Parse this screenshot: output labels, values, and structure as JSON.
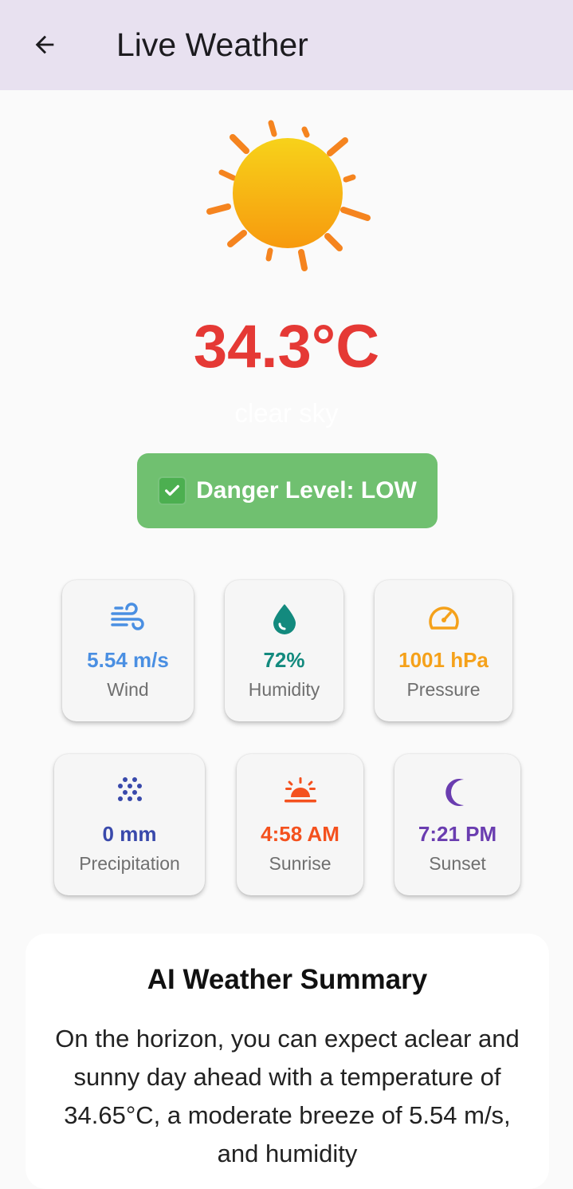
{
  "appbar": {
    "title": "Live Weather",
    "back_icon": "arrow-left-icon"
  },
  "current": {
    "icon": "sun-icon",
    "temperature": "34.3°C",
    "description": "clear sky",
    "danger_text": "Danger Level: LOW",
    "danger_icon": "check-mark-icon"
  },
  "stats": [
    {
      "label": "Wind",
      "value": "5.54 m/s",
      "icon": "wind-icon",
      "color": "#4a8fe2"
    },
    {
      "label": "Humidity",
      "value": "72%",
      "icon": "water-drop-icon",
      "color": "#138a7e"
    },
    {
      "label": "Pressure",
      "value": "1001 hPa",
      "icon": "gauge-icon",
      "color": "#f5a11a"
    },
    {
      "label": "Precipitation",
      "value": "0 mm",
      "icon": "precipitation-icon",
      "color": "#3949ab"
    },
    {
      "label": "Sunrise",
      "value": "4:58 AM",
      "icon": "sunrise-icon",
      "color": "#f4511e"
    },
    {
      "label": "Sunset",
      "value": "7:21 PM",
      "icon": "moon-icon",
      "color": "#6a3db0"
    }
  ],
  "summary": {
    "title": "AI Weather Summary",
    "body": "On the horizon, you can expect aclear and sunny day ahead with a temperature of 34.65°C, a moderate breeze of 5.54 m/s, and humidity"
  },
  "colors": {
    "appbar_bg": "#e8e1f0",
    "temperature": "#e53935",
    "danger_bg": "#70c070"
  }
}
